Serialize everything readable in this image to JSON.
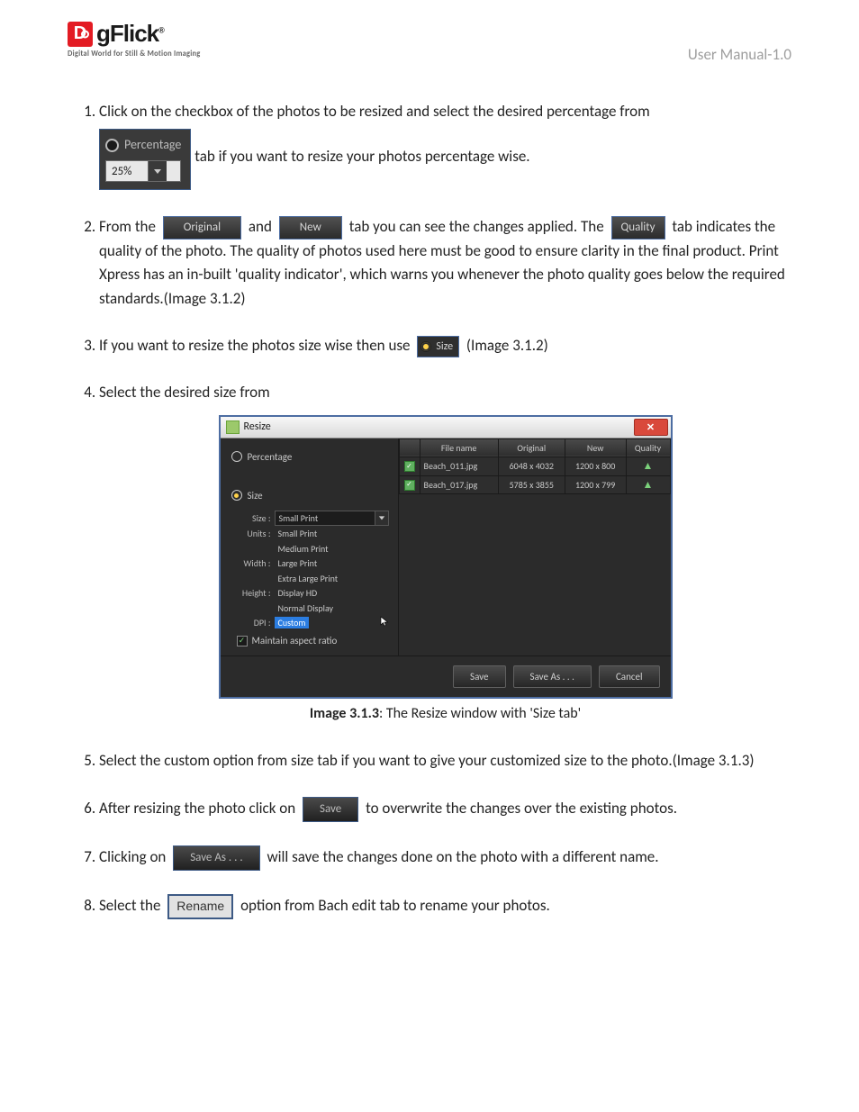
{
  "logo": {
    "brand": "gFlick",
    "dletter": "D",
    "tagline": "Digital World for Still & Motion Imaging",
    "trademark": "®"
  },
  "headerRight": "User Manual-1.0",
  "steps": {
    "s1": {
      "lead": "Click on the checkbox of the photos to be resized and select the desired percentage from",
      "percentLabel": "Percentage",
      "percentValue": "25%",
      "tail": " tab if you want to resize your photos percentage wise."
    },
    "s2": {
      "p1": "From the ",
      "original": "Original",
      "mid": " and ",
      "newLbl": "New",
      "p2": " tab you can see the changes applied. The ",
      "quality": "Quality",
      "tail": " tab indicates the quality of the photo. The quality of photos used here must be good to ensure clarity in the final product. Print Xpress has an in-built 'quality indicator', which warns you whenever the photo quality goes below the required standards.(Image 3.1.2)"
    },
    "s3": {
      "p1": "If you want to resize the photos size wise then use ",
      "sizeLbl": "Size",
      "tail": " (Image 3.1.2)"
    },
    "s4": {
      "lead": "Select the desired size from",
      "caption_b": "Image 3.1.3",
      "caption_t": ": The Resize window with 'Size tab'"
    },
    "s5": "Select the custom option from size tab if you want to give your customized size to the photo.(Image 3.1.3)",
    "s6": {
      "p1": "After resizing the photo click on ",
      "save": "Save",
      "tail": " to overwrite the changes over the existing photos."
    },
    "s7": {
      "p1": "Clicking on ",
      "saveas": "Save As . . .",
      "tail": " will save the changes done on the photo with a different name."
    },
    "s8": {
      "p1": "Select the ",
      "rename": "Rename",
      "tail": " option from Bach edit tab to rename your photos."
    }
  },
  "resizeWin": {
    "title": "Resize",
    "close": "✕",
    "percentage": "Percentage",
    "size": "Size",
    "labels": {
      "size": "Size :",
      "units": "Units :",
      "width": "Width :",
      "height": "Height :",
      "dpi": "DPI :"
    },
    "sizeSelected": "Small Print",
    "options": [
      "Small Print",
      "Medium Print",
      "Large Print",
      "Extra Large Print",
      "Display HD",
      "Normal Display",
      "Custom"
    ],
    "maintain": "Maintain aspect ratio",
    "cols": {
      "c0": "",
      "c1": "File name",
      "c2": "Original",
      "c3": "New",
      "c4": "Quality"
    },
    "rows": [
      {
        "fn": "Beach_011.jpg",
        "orig": "6048 x 4032",
        "new": "1200 x 800"
      },
      {
        "fn": "Beach_017.jpg",
        "orig": "5785 x 3855",
        "new": "1200 x 799"
      }
    ],
    "buttons": {
      "save": "Save",
      "saveas": "Save As . . .",
      "cancel": "Cancel"
    }
  }
}
